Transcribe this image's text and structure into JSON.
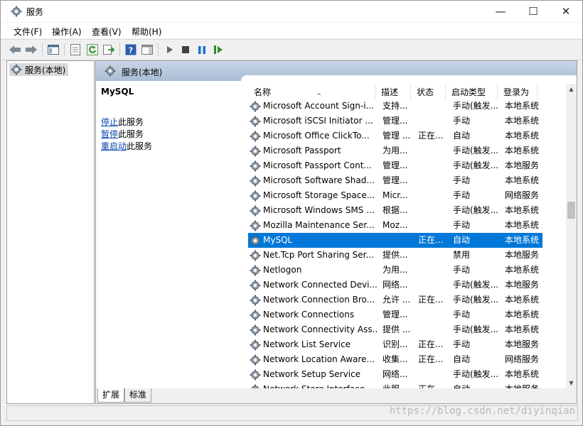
{
  "window": {
    "title": "服务",
    "min_glyph": "—",
    "max_glyph": "☐",
    "close_glyph": "✕",
    "icon": "gear-icon"
  },
  "menu": [
    "文件(F)",
    "操作(A)",
    "查看(V)",
    "帮助(H)"
  ],
  "toolbar": {
    "icons": [
      "back-arrow-icon",
      "forward-arrow-icon",
      "show-hide-tree-icon",
      "properties-icon",
      "refresh-icon",
      "export-list-icon",
      "help-icon",
      "show-action-pane-icon",
      "start-service-icon",
      "stop-service-icon",
      "pause-service-icon",
      "restart-service-icon"
    ]
  },
  "tree": {
    "label": "服务(本地)"
  },
  "pane_header": "服务(本地)",
  "selected_service": {
    "name": "MySQL",
    "actions": [
      {
        "link": "停止",
        "suffix": "此服务"
      },
      {
        "link": "暂停",
        "suffix": "此服务"
      },
      {
        "link": "重启动",
        "suffix": "此服务"
      }
    ]
  },
  "columns": [
    "名称",
    "描述",
    "状态",
    "启动类型",
    "登录为"
  ],
  "rows": [
    {
      "name": "Microsoft Account Sign-i...",
      "desc": "支持...",
      "state": "",
      "start": "手动(触发...",
      "logon": "本地系统"
    },
    {
      "name": "Microsoft iSCSI Initiator ...",
      "desc": "管理...",
      "state": "",
      "start": "手动",
      "logon": "本地系统"
    },
    {
      "name": "Microsoft Office ClickTo...",
      "desc": "管理 ...",
      "state": "正在...",
      "start": "自动",
      "logon": "本地系统"
    },
    {
      "name": "Microsoft Passport",
      "desc": "为用...",
      "state": "",
      "start": "手动(触发...",
      "logon": "本地系统"
    },
    {
      "name": "Microsoft Passport Cont...",
      "desc": "管理...",
      "state": "",
      "start": "手动(触发...",
      "logon": "本地服务"
    },
    {
      "name": "Microsoft Software Shad...",
      "desc": "管理...",
      "state": "",
      "start": "手动",
      "logon": "本地系统"
    },
    {
      "name": "Microsoft Storage Space...",
      "desc": "Micr...",
      "state": "",
      "start": "手动",
      "logon": "网络服务"
    },
    {
      "name": "Microsoft Windows SMS ...",
      "desc": "根据...",
      "state": "",
      "start": "手动(触发...",
      "logon": "本地系统"
    },
    {
      "name": "Mozilla Maintenance Ser...",
      "desc": "Moz...",
      "state": "",
      "start": "手动",
      "logon": "本地系统"
    },
    {
      "name": "MySQL",
      "desc": "",
      "state": "正在...",
      "start": "自动",
      "logon": "本地系统",
      "selected": true
    },
    {
      "name": "Net.Tcp Port Sharing Ser...",
      "desc": "提供...",
      "state": "",
      "start": "禁用",
      "logon": "本地服务"
    },
    {
      "name": "Netlogon",
      "desc": "为用...",
      "state": "",
      "start": "手动",
      "logon": "本地系统"
    },
    {
      "name": "Network Connected Devi...",
      "desc": "网络...",
      "state": "",
      "start": "手动(触发...",
      "logon": "本地服务"
    },
    {
      "name": "Network Connection Bro...",
      "desc": "允许 ...",
      "state": "正在...",
      "start": "手动(触发...",
      "logon": "本地系统"
    },
    {
      "name": "Network Connections",
      "desc": "管理...",
      "state": "",
      "start": "手动",
      "logon": "本地系统"
    },
    {
      "name": "Network Connectivity Ass...",
      "desc": "提供 ...",
      "state": "",
      "start": "手动(触发...",
      "logon": "本地系统"
    },
    {
      "name": "Network List Service",
      "desc": "识别...",
      "state": "正在...",
      "start": "手动",
      "logon": "本地服务"
    },
    {
      "name": "Network Location Aware...",
      "desc": "收集...",
      "state": "正在...",
      "start": "自动",
      "logon": "网络服务"
    },
    {
      "name": "Network Setup Service",
      "desc": "网络...",
      "state": "",
      "start": "手动(触发...",
      "logon": "本地系统"
    },
    {
      "name": "Network Store Interface ...",
      "desc": "此服...",
      "state": "正在...",
      "start": "自动",
      "logon": "本地服务"
    }
  ],
  "tabs": [
    "扩展",
    "标准"
  ],
  "watermark": "https://blog.csdn.net/diyinqian"
}
